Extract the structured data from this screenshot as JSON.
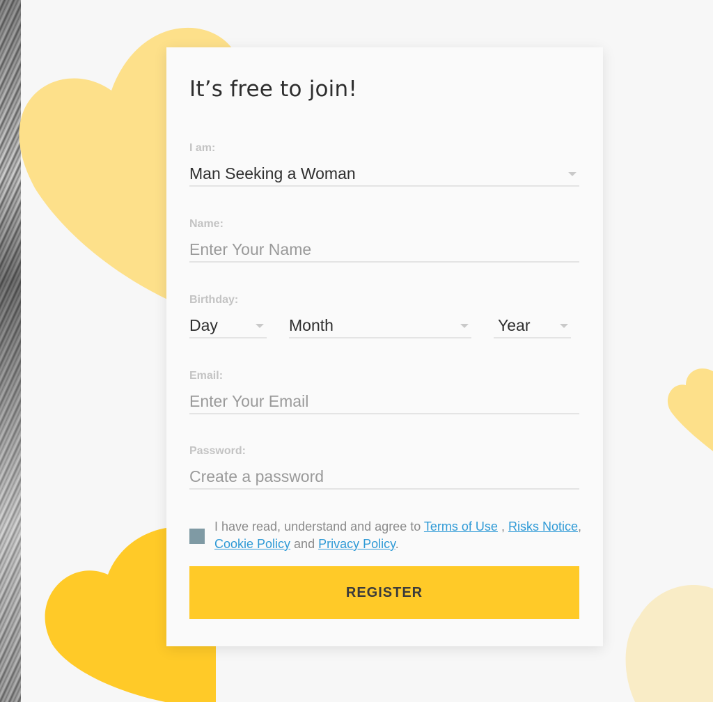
{
  "form": {
    "title": "It’s free to join!",
    "seeking": {
      "label": "I am:",
      "value": "Man Seeking a Woman"
    },
    "name": {
      "label": "Name:",
      "placeholder": "Enter Your Name"
    },
    "birthday": {
      "label": "Birthday:",
      "day": "Day",
      "month": "Month",
      "year": "Year"
    },
    "email": {
      "label": "Email:",
      "placeholder": "Enter Your Email"
    },
    "password": {
      "label": "Password:",
      "placeholder": "Create a password"
    },
    "consent": {
      "prefix": "I have read, understand and agree to ",
      "terms": "Terms of Use",
      "sep1": " , ",
      "risks": "Risks Notice",
      "sep2": ", ",
      "cookie": "Cookie Policy",
      "sep3": " and ",
      "privacy": "Privacy Policy",
      "suffix": "."
    },
    "register_label": "REGISTER"
  },
  "colors": {
    "accent": "#ffca28",
    "heart_light": "#fde08a",
    "heart_pale": "#f9ecc6",
    "link": "#2f9ad6",
    "checkbox": "#7f9aa4"
  }
}
